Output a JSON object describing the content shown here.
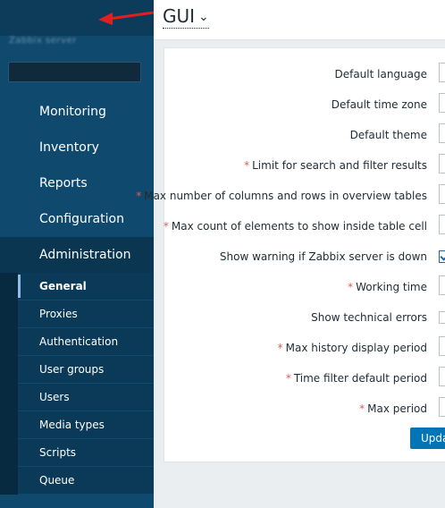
{
  "sidebar": {
    "server_name": "Zabbix server",
    "menu": [
      {
        "label": "Monitoring"
      },
      {
        "label": "Inventory"
      },
      {
        "label": "Reports"
      },
      {
        "label": "Configuration"
      },
      {
        "label": "Administration"
      }
    ],
    "submenu": [
      {
        "label": "General"
      },
      {
        "label": "Proxies"
      },
      {
        "label": "Authentication"
      },
      {
        "label": "User groups"
      },
      {
        "label": "Users"
      },
      {
        "label": "Media types"
      },
      {
        "label": "Scripts"
      },
      {
        "label": "Queue"
      }
    ]
  },
  "header": {
    "title": "GUI"
  },
  "form": {
    "rows": [
      {
        "label": "Default language",
        "required": false
      },
      {
        "label": "Default time zone",
        "required": false
      },
      {
        "label": "Default theme",
        "required": false
      },
      {
        "label": "Limit for search and filter results",
        "required": true
      },
      {
        "label": "Max number of columns and rows in overview tables",
        "required": true
      },
      {
        "label": "Max count of elements to show inside table cell",
        "required": true
      },
      {
        "label": "Show warning if Zabbix server is down",
        "required": false
      },
      {
        "label": "Working time",
        "required": true
      },
      {
        "label": "Show technical errors",
        "required": false
      },
      {
        "label": "Max history display period",
        "required": true
      },
      {
        "label": "Time filter default period",
        "required": true
      },
      {
        "label": "Max period",
        "required": true
      }
    ],
    "update_label": "Upda"
  },
  "colors": {
    "accent": "#0275b8",
    "sidebar": "#0f4a6e",
    "required": "#e45959"
  }
}
